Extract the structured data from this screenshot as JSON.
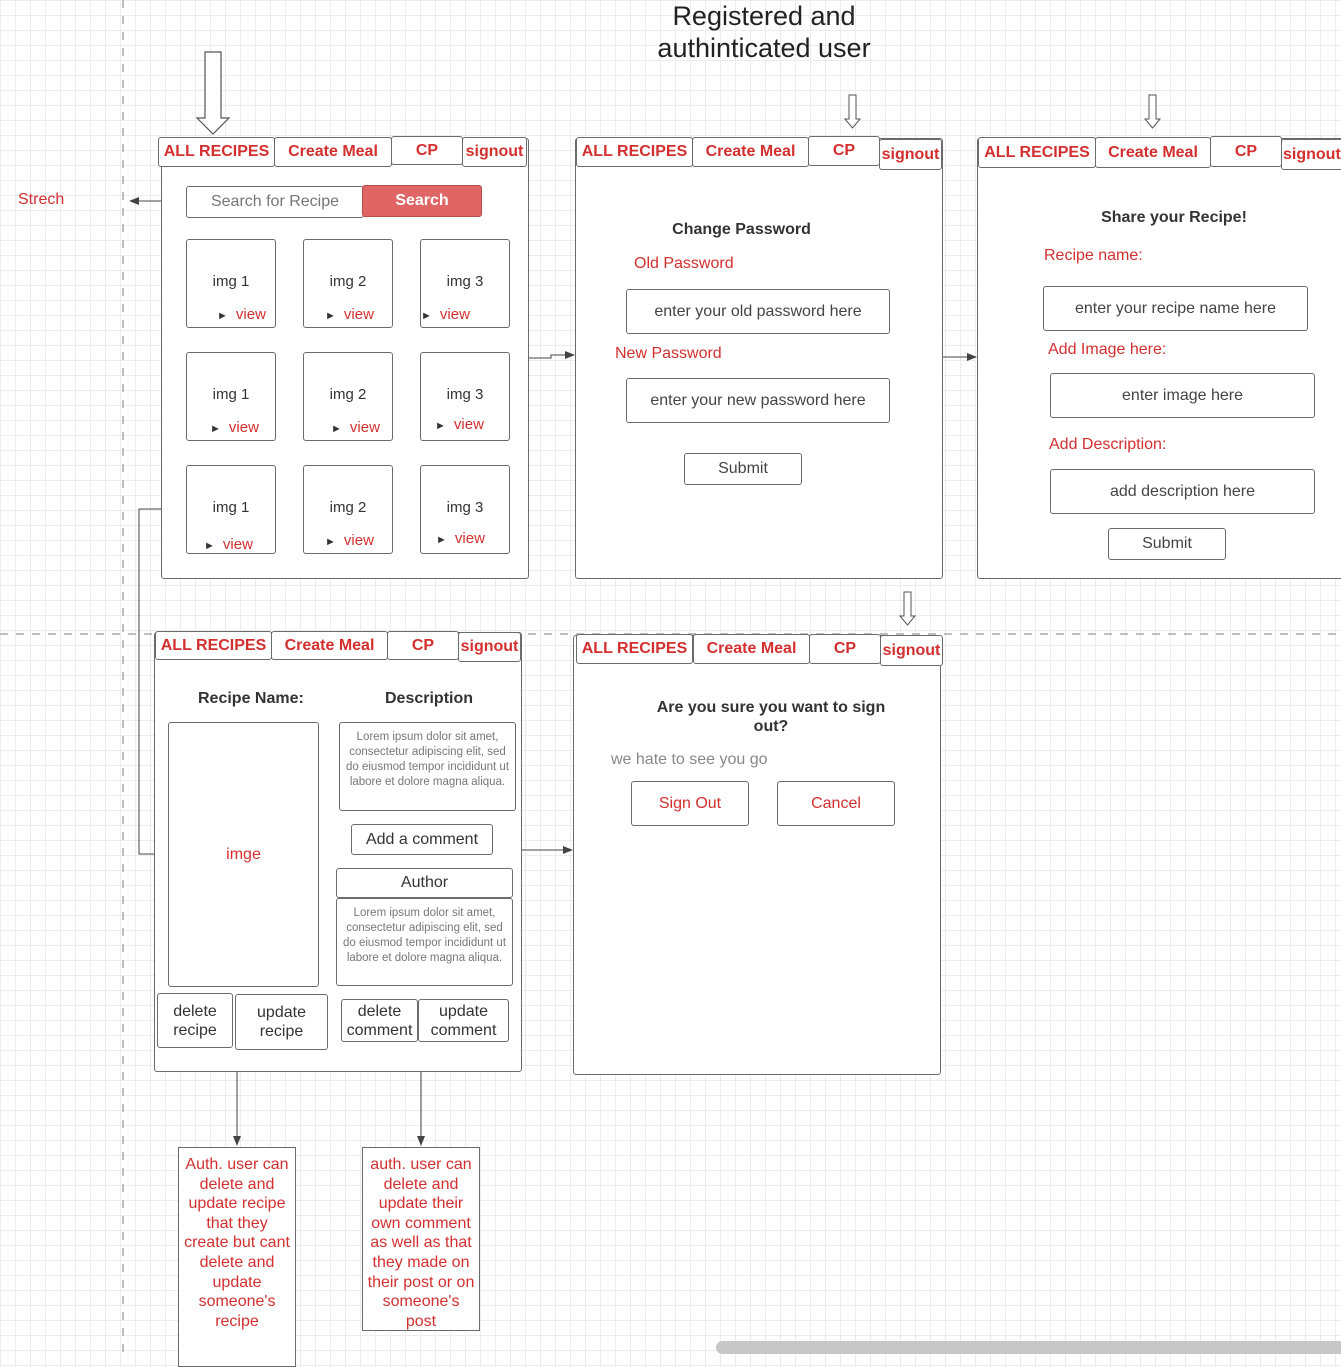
{
  "title": "Registered and authinticated user",
  "streich_label": "Strech",
  "nav": {
    "all": "ALL RECIPES",
    "create": "Create Meal",
    "cp": "CP",
    "signout": "signout"
  },
  "home": {
    "search_placeholder": "Search for Recipe",
    "search_button": "Search",
    "view": "view",
    "cards": [
      "img 1",
      "img 2",
      "img 3",
      "img 1",
      "img 2",
      "img 3",
      "img 1",
      "img 2",
      "img 3"
    ]
  },
  "change_password": {
    "heading": "Change Password",
    "old_label": "Old Password",
    "old_placeholder": "enter your old password here",
    "new_label": "New Password",
    "new_placeholder": "enter your new password here",
    "submit": "Submit"
  },
  "share": {
    "heading": "Share your Recipe!",
    "name_label": "Recipe name:",
    "name_placeholder": "enter your recipe name here",
    "image_label": "Add Image here:",
    "image_placeholder": "enter image here",
    "desc_label": "Add Description:",
    "desc_placeholder": "add description here",
    "submit": "Submit"
  },
  "detail": {
    "name_header": "Recipe Name:",
    "desc_header": "Description",
    "image_label": "imge",
    "lorem": "Lorem ipsum dolor sit amet, consectetur adipiscing elit, sed do eiusmod tempor incididunt ut labore et dolore magna aliqua.",
    "add_comment": "Add a comment",
    "author": "Author",
    "delete_recipe": "delete recipe",
    "update_recipe": "update recipe",
    "delete_comment": "delete comment",
    "update_comment": "update comment"
  },
  "signout_page": {
    "question": "Are you sure you want to sign out?",
    "subtext": "we hate to see you go",
    "sign_out": "Sign Out",
    "cancel": "Cancel"
  },
  "notes": {
    "recipe_note": "Auth. user can delete and update recipe that they create but cant delete and update someone's recipe",
    "comment_note": "auth. user can delete and update their own comment as well as that they made on their post or on someone's post"
  }
}
